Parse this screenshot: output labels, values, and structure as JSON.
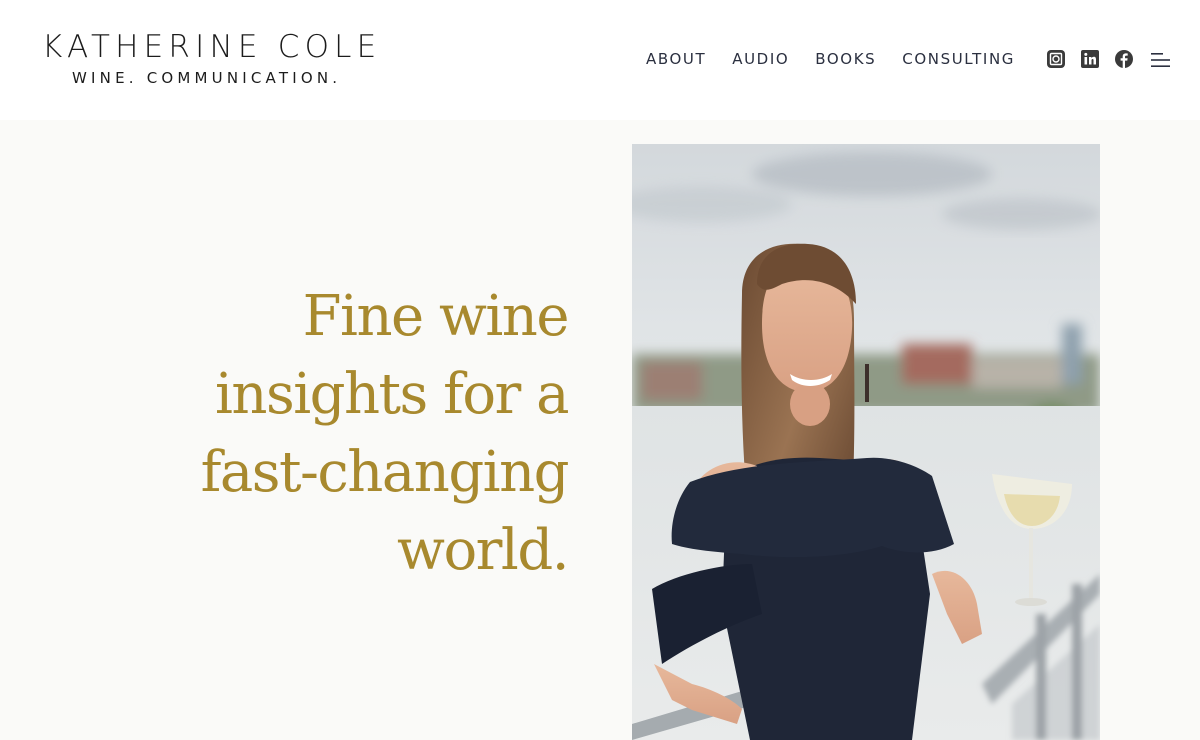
{
  "brand": {
    "name": "KATHERINE COLE",
    "tagline": "WINE. COMMUNICATION."
  },
  "nav": {
    "items": [
      {
        "label": "ABOUT"
      },
      {
        "label": "AUDIO"
      },
      {
        "label": "BOOKS"
      },
      {
        "label": "CONSULTING"
      }
    ]
  },
  "social": {
    "icons": [
      "instagram-icon",
      "linkedin-icon",
      "facebook-icon"
    ],
    "icon_color": "#3a3a3a"
  },
  "menu": {
    "icon": "menu-icon"
  },
  "hero": {
    "headline_lines": [
      "Fine wine",
      "insights for a",
      "fast-changing",
      "world."
    ],
    "headline_color": "#a8892e",
    "background": "#fafaf8"
  }
}
